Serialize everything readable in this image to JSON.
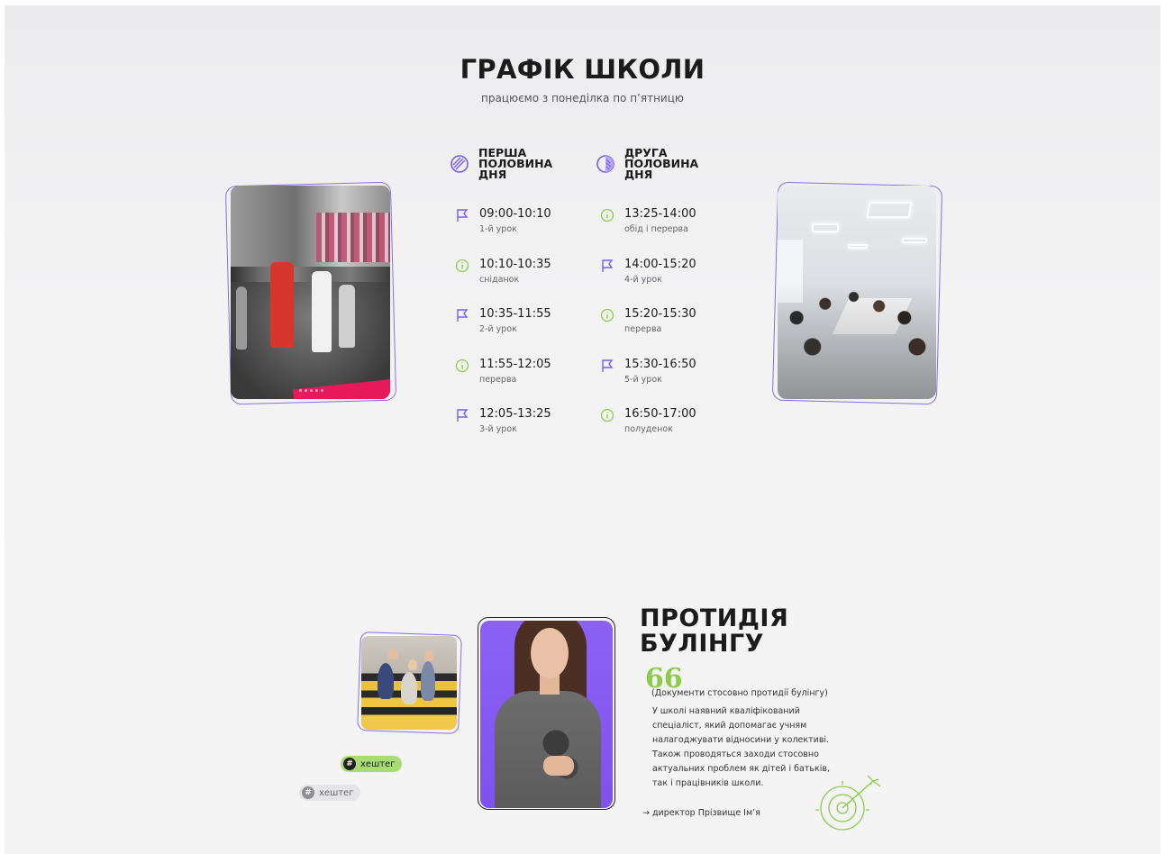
{
  "schedule": {
    "title": "ГРАФІК ШКОЛИ",
    "subtitle": "працюємо з понеділка по п’ятницю",
    "first_half": {
      "title": "ПЕРША ПОЛОВИНА ДНЯ",
      "icon": "half-circle-striped-icon",
      "slots": [
        {
          "time": "09:00-10:10",
          "label": "1-й урок",
          "icon": "flag-icon"
        },
        {
          "time": "10:10-10:35",
          "label": "сніданок",
          "icon": "info-icon"
        },
        {
          "time": "10:35-11:55",
          "label": "2-й урок",
          "icon": "flag-icon"
        },
        {
          "time": "11:55-12:05",
          "label": "перерва",
          "icon": "info-icon"
        },
        {
          "time": "12:05-13:25",
          "label": "3-й урок",
          "icon": "flag-icon"
        }
      ]
    },
    "second_half": {
      "title": "ДРУГА ПОЛОВИНА ДНЯ",
      "icon": "half-circle-filled-icon",
      "slots": [
        {
          "time": "13:25-14:00",
          "label": "обід і перерва",
          "icon": "info-icon"
        },
        {
          "time": "14:00-15:20",
          "label": "4-й урок",
          "icon": "flag-icon"
        },
        {
          "time": "15:20-15:30",
          "label": "перерва",
          "icon": "info-icon"
        },
        {
          "time": "15:30-16:50",
          "label": "5-й урок",
          "icon": "flag-icon"
        },
        {
          "time": "16:50-17:00",
          "label": "полуденок",
          "icon": "info-icon"
        }
      ]
    }
  },
  "bullying": {
    "title": "ПРОТИДІЯ БУЛІНГУ",
    "quote_mark": "66",
    "docs": "(Документи стосовно протидії булінгу)",
    "text": "У школі наявний кваліфікований спеціаліст, який допомагає учням налагоджувати відносини у колективі. Також проводяться заходи стосовно актуальних проблем як дітей і батьків, так і працівників школи.",
    "signature": "→ директор Прізвище Ім’я",
    "tags": [
      "хештег",
      "хештег"
    ]
  },
  "colors": {
    "accent_purple": "#8a6cf0",
    "accent_green": "#8ccc4a",
    "tag_green": "#a9dd73"
  }
}
